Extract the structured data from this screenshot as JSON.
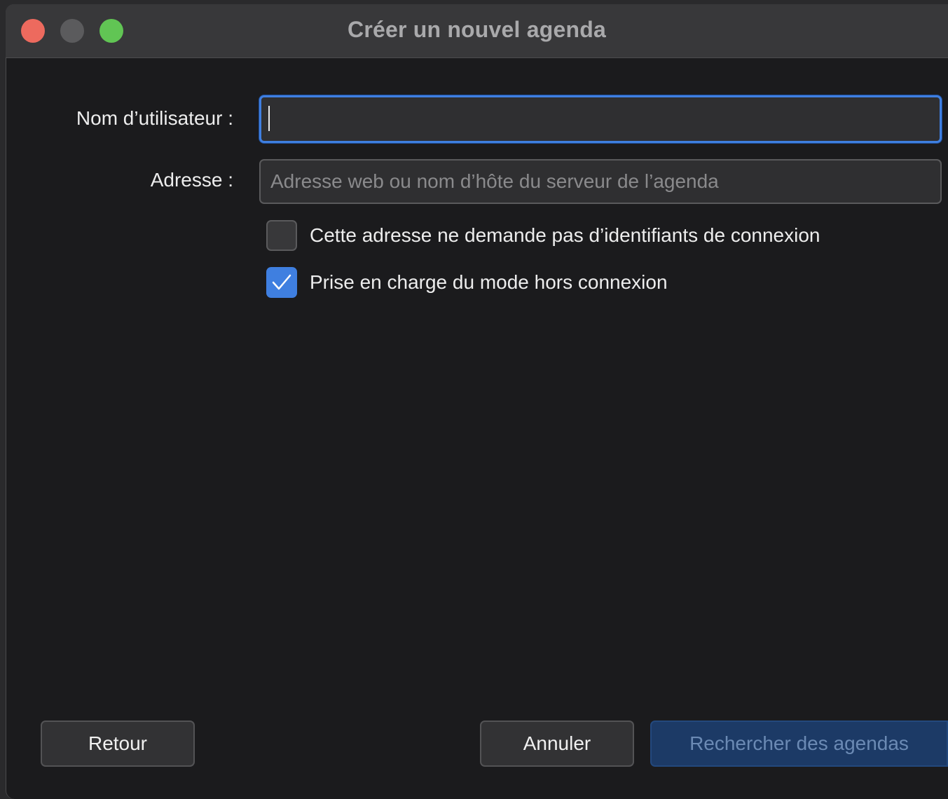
{
  "window": {
    "title": "Créer un nouvel agenda"
  },
  "form": {
    "username_label": "Nom d’utilisateur :",
    "username_value": "",
    "address_label": "Adresse :",
    "address_placeholder": "Adresse web ou nom d’hôte du serveur de l’agenda",
    "no_credentials_label": "Cette adresse ne demande pas d’identifiants de connexion",
    "no_credentials_checked": false,
    "offline_label": "Prise en charge du mode hors connexion",
    "offline_checked": true
  },
  "buttons": {
    "back_label": "Retour",
    "cancel_label": "Annuler",
    "search_label": "Rechercher des agendas"
  },
  "colors": {
    "accent": "#3f7fe0",
    "close": "#ed6a5e",
    "minimize_inactive": "#5b5b5d",
    "maximize": "#61c554"
  }
}
